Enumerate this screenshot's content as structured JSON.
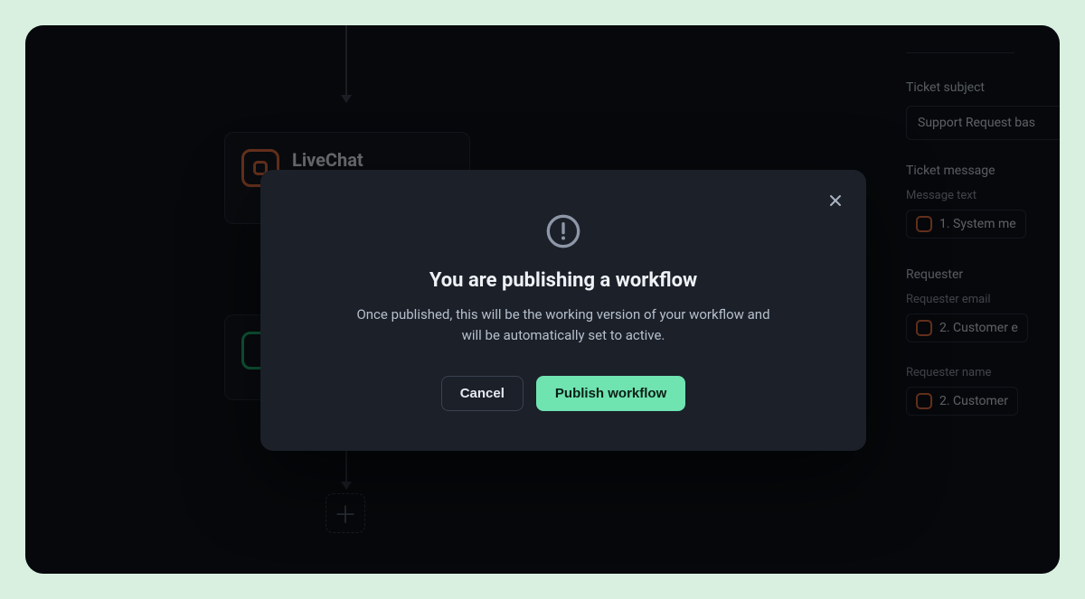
{
  "canvas": {
    "node1": {
      "title": "LiveChat"
    },
    "plus_glyph": "＋"
  },
  "sidebar": {
    "ticket_subject_label": "Ticket subject",
    "ticket_subject_value": "Support Request bas",
    "ticket_message_label": "Ticket message",
    "message_text_label": "Message text",
    "message_text_chip": "1. System me",
    "requester_label": "Requester",
    "requester_email_label": "Requester email",
    "requester_email_chip": "2. Customer e",
    "requester_name_label": "Requester name",
    "requester_name_chip": "2. Customer"
  },
  "modal": {
    "title": "You are publishing a workflow",
    "body": "Once published, this will be the working version of your workflow and will be automatically set to active.",
    "cancel": "Cancel",
    "publish": "Publish workflow"
  }
}
